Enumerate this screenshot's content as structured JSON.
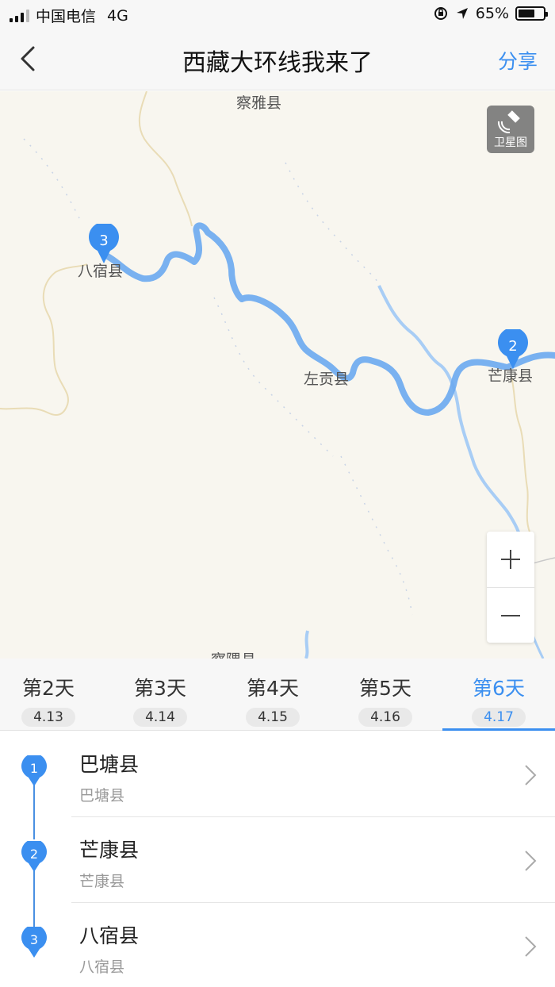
{
  "status_bar": {
    "carrier": "中国电信",
    "network": "4G",
    "battery_percent": "65%",
    "battery_level": 0.65,
    "icons": [
      "signal-icon",
      "rotation-lock-icon",
      "location-arrow-icon",
      "battery-icon"
    ]
  },
  "nav": {
    "title": "西藏大环线我来了",
    "share_label": "分享",
    "back_icon": "chevron-left-icon"
  },
  "map": {
    "satellite_label": "卫星图",
    "labels": {
      "chaya": "察雅县",
      "basu": "八宿县",
      "zuogong": "左贡县",
      "mangkang": "芒康县",
      "chayu": "察隅县"
    },
    "markers": [
      {
        "number": "2",
        "place": "芒康县"
      },
      {
        "number": "3",
        "place": "八宿县"
      }
    ],
    "route_color": "#6aaaf0",
    "marker_color": "#3b8ff0"
  },
  "day_tabs": [
    {
      "name": "第2天",
      "date": "4.13",
      "active": false
    },
    {
      "name": "第3天",
      "date": "4.14",
      "active": false
    },
    {
      "name": "第4天",
      "date": "4.15",
      "active": false
    },
    {
      "name": "第5天",
      "date": "4.16",
      "active": false
    },
    {
      "name": "第6天",
      "date": "4.17",
      "active": true
    }
  ],
  "stops": [
    {
      "number": "1",
      "name": "巴塘县",
      "sub": "巴塘县"
    },
    {
      "number": "2",
      "name": "芒康县",
      "sub": "芒康县"
    },
    {
      "number": "3",
      "name": "八宿县",
      "sub": "八宿县"
    }
  ],
  "colors": {
    "accent": "#3b8ff0",
    "text": "#222222",
    "subtext": "#999999"
  }
}
